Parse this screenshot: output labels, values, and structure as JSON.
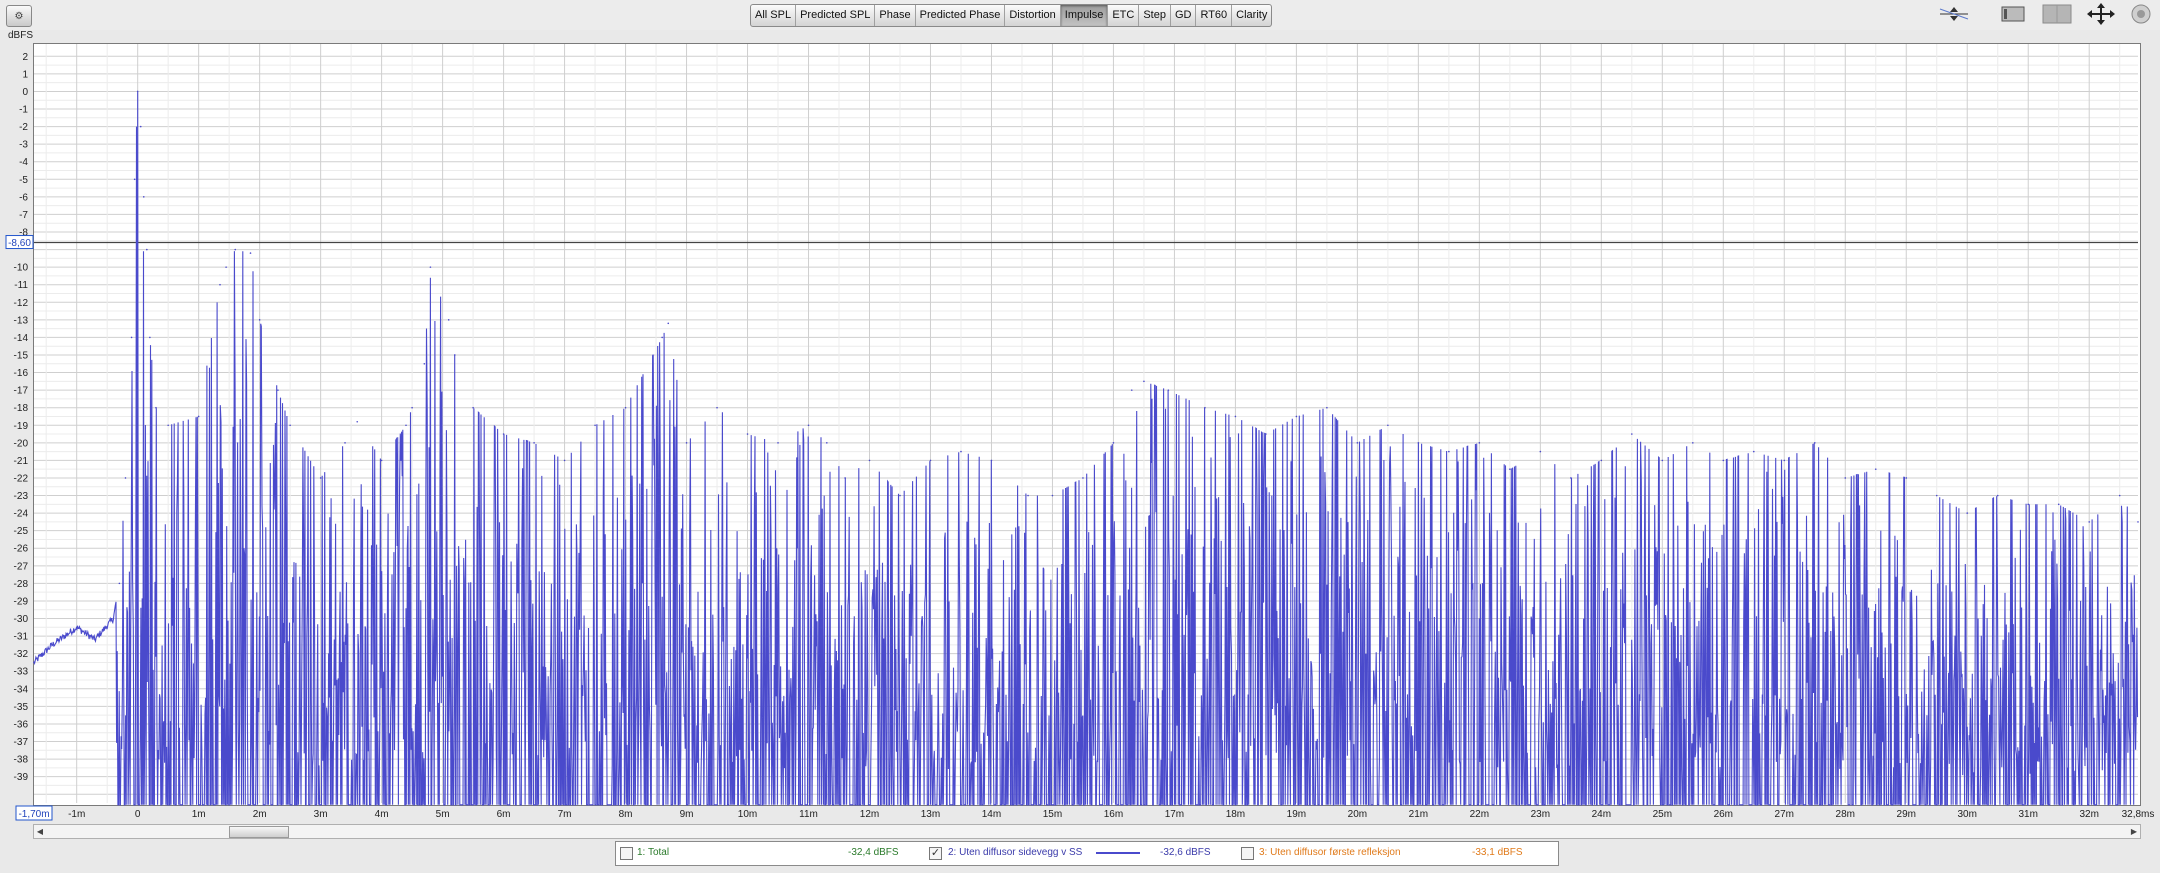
{
  "toolbar": {
    "menu_icon": "gear-icon",
    "tabs": [
      "All SPL",
      "Predicted SPL",
      "Phase",
      "Predicted Phase",
      "Distortion",
      "Impulse",
      "ETC",
      "Step",
      "GD",
      "RT60",
      "Clarity"
    ],
    "active_tab": "Impulse",
    "tool_icons": [
      "limits-icon",
      "controls-icon",
      "capture-icon",
      "pan-icon",
      "settings-icon"
    ]
  },
  "colors": {
    "trace": "#4a4acc",
    "legend_1": "#2a7a2a",
    "legend_2": "#3a3aaa",
    "legend_3": "#e07a1a"
  },
  "cursor": {
    "y_readout": "-8,60",
    "x_readout": "-1,70m"
  },
  "legend": {
    "items": [
      {
        "label": "1: Total",
        "value": "-32,4 dBFS",
        "checked": false
      },
      {
        "label": "2: Uten diffusor sidevegg v SS",
        "value": "-32,6 dBFS",
        "checked": true
      },
      {
        "label": "3: Uten diffusor første refleksjon",
        "value": "-33,1 dBFS",
        "checked": false
      }
    ]
  },
  "chart_data": {
    "type": "line",
    "ylabel": "dBFS",
    "xlabel": "",
    "xlim": [
      -1.7,
      32.8
    ],
    "ylim": [
      -40.5,
      2.7
    ],
    "x_ticks": [
      "-1m",
      "0",
      "1m",
      "2m",
      "3m",
      "4m",
      "5m",
      "6m",
      "7m",
      "8m",
      "9m",
      "10m",
      "11m",
      "12m",
      "13m",
      "14m",
      "15m",
      "16m",
      "17m",
      "18m",
      "19m",
      "20m",
      "21m",
      "22m",
      "23m",
      "24m",
      "25m",
      "26m",
      "27m",
      "28m",
      "29m",
      "30m",
      "31m",
      "32m",
      "32,8ms"
    ],
    "y_ticks": [
      "2",
      "1",
      "0",
      "-1",
      "-2",
      "-3",
      "-4",
      "-5",
      "-6",
      "-7",
      "-8",
      "-10",
      "-11",
      "-12",
      "-13",
      "-14",
      "-15",
      "-16",
      "-17",
      "-18",
      "-19",
      "-20",
      "-21",
      "-22",
      "-23",
      "-24",
      "-25",
      "-26",
      "-27",
      "-28",
      "-29",
      "-30",
      "-31",
      "-32",
      "-33",
      "-34",
      "-35",
      "-36",
      "-37",
      "-38",
      "-39"
    ],
    "grid": true,
    "cursor_y": -8.6,
    "series": [
      {
        "x": [
          -1.7,
          -1.4,
          -1.0,
          -0.7,
          -0.4,
          -0.3,
          -0.2,
          -0.1,
          -0.05,
          0.0,
          0.05,
          0.1,
          0.15,
          0.2,
          0.3,
          0.5,
          1.0,
          1.35,
          1.45,
          1.6,
          1.85,
          2.0,
          2.3,
          2.5,
          3.0,
          3.4,
          3.6,
          4.0,
          4.4,
          4.5,
          4.7,
          4.8,
          5.1,
          5.2,
          5.5,
          6.0,
          6.5,
          7.0,
          7.5,
          8.0,
          8.6,
          8.7,
          9.0,
          9.5,
          10.0,
          10.5,
          11.0,
          11.3,
          11.6,
          12.0,
          12.5,
          13.0,
          13.5,
          14.0,
          14.6,
          15.0,
          15.5,
          16.0,
          16.3,
          16.5,
          16.9,
          17.5,
          18.0,
          18.5,
          19.0,
          19.5,
          20.0,
          20.5,
          21.0,
          21.5,
          22.0,
          22.5,
          23.0,
          23.5,
          24.0,
          24.5,
          25.0,
          25.5,
          26.0,
          26.5,
          27.0,
          27.5,
          28.0,
          28.5,
          29.0,
          29.5,
          30.0,
          30.5,
          31.0,
          31.5,
          32.0,
          32.5,
          32.8
        ],
        "y": [
          -32.5,
          -31.5,
          -30.5,
          -31.2,
          -30.0,
          -28.0,
          -22.0,
          -14.0,
          -5.0,
          0.0,
          -2.0,
          -6.0,
          -9.0,
          -14.0,
          -18.0,
          -19.0,
          -18.5,
          -11.0,
          -10.0,
          -9.0,
          -9.2,
          -13.0,
          -17.0,
          -19.0,
          -22.0,
          -20.0,
          -18.8,
          -21.0,
          -19.0,
          -18.0,
          -15.5,
          -10.0,
          -13.0,
          -15.0,
          -18.0,
          -19.5,
          -20.0,
          -21.0,
          -19.0,
          -18.0,
          -14.0,
          -13.2,
          -20.0,
          -18.0,
          -19.5,
          -20.0,
          -19.0,
          -20.0,
          -22.0,
          -21.0,
          -23.0,
          -21.0,
          -20.5,
          -21.0,
          -23.0,
          -23.0,
          -22.0,
          -20.0,
          -17.0,
          -16.5,
          -17.0,
          -18.0,
          -18.5,
          -19.5,
          -18.5,
          -18.0,
          -20.0,
          -19.0,
          -20.0,
          -20.5,
          -20.0,
          -21.5,
          -20.5,
          -22.0,
          -21.0,
          -19.5,
          -21.0,
          -20.0,
          -21.0,
          -20.5,
          -21.0,
          -20.0,
          -22.0,
          -21.5,
          -22.0,
          -23.0,
          -24.0,
          -23.0,
          -23.5,
          -23.5,
          -24.5,
          -23.0,
          -24.5
        ],
        "note_style": "dense oscillating impulse envelope"
      }
    ]
  }
}
